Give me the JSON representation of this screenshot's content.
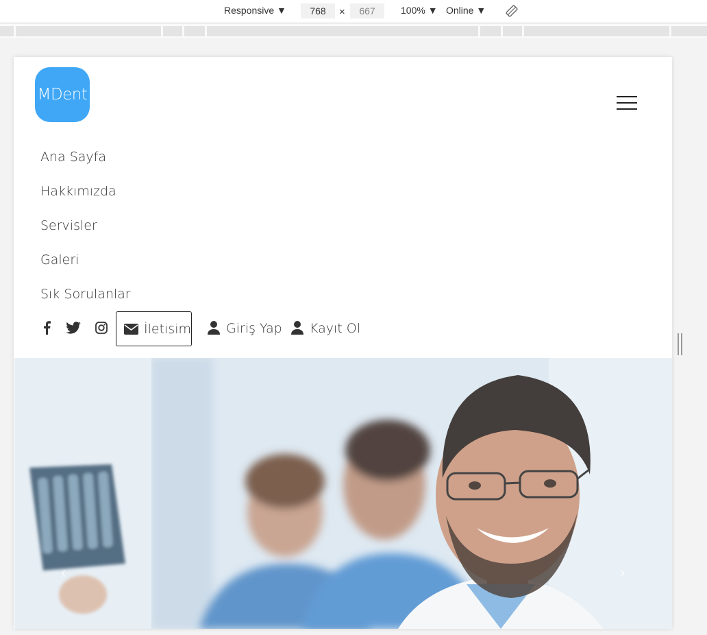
{
  "devtools": {
    "device": "Responsive",
    "width": "768",
    "times": "×",
    "height": "667",
    "zoom": "100%",
    "throttle": "Online"
  },
  "logo": {
    "text": "MDent"
  },
  "nav": {
    "items": [
      "Ana Sayfa",
      "Hakkımızda",
      "Servisler",
      "Galeri",
      "Sık Sorulanlar"
    ]
  },
  "header_links": {
    "contact": "İletisim",
    "login": "Giriş Yap",
    "register": "Kayıt Ol"
  },
  "carousel": {
    "prev": "‹",
    "next": "›"
  },
  "colors": {
    "logo_bg": "#3fa7f5",
    "text": "#333333"
  }
}
